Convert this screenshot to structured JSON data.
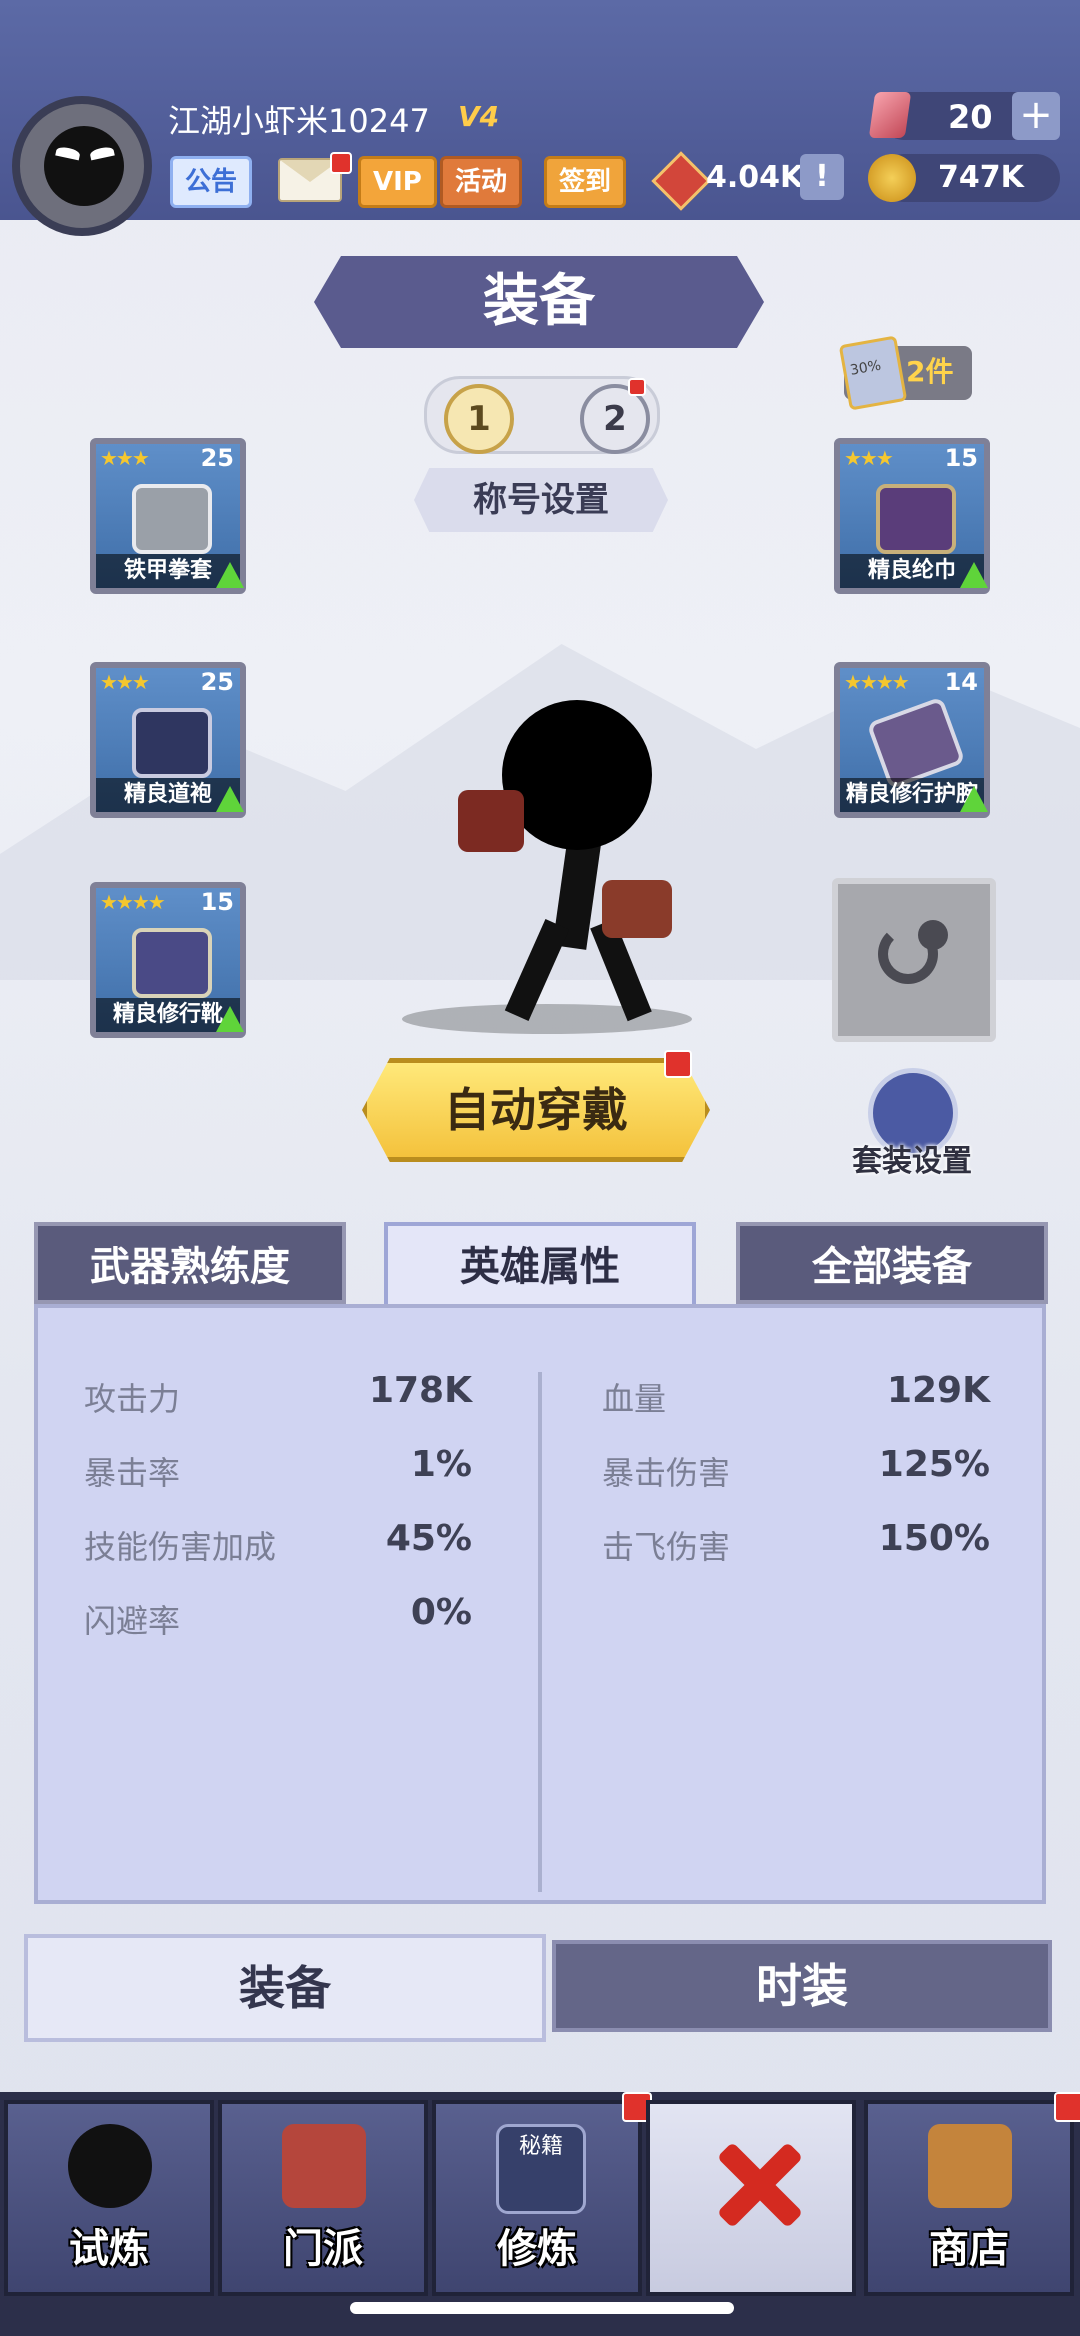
{
  "header": {
    "player_name": "江湖小虾米10247",
    "vip_level": "V4",
    "notice_label": "公告",
    "vip_label": "VIP",
    "event_label": "活动",
    "checkin_label": "签到",
    "honor_value": "4.04K",
    "info_symbol": "!",
    "gems": "20",
    "add_symbol": "+",
    "coins": "747K"
  },
  "equip_screen": {
    "title": "装备",
    "slot_tabs": [
      "1",
      "2"
    ],
    "title_settings_label": "称号设置",
    "set_pieces_label": "2件",
    "set_badge_text": "30%",
    "auto_equip_label": "自动穿戴",
    "suit_settings_label": "套装设置",
    "slots": {
      "gloves": {
        "name": "铁甲拳套",
        "stars": "★★★",
        "level": "25"
      },
      "robe": {
        "name": "精良道袍",
        "stars": "★★★",
        "level": "25"
      },
      "boots": {
        "name": "精良修行靴",
        "stars": "★★★★",
        "level": "15"
      },
      "hat": {
        "name": "精良纶巾",
        "stars": "★★★",
        "level": "15"
      },
      "bracer": {
        "name": "精良修行护腕",
        "stars": "★★★★",
        "level": "14"
      }
    }
  },
  "stat_tabs": [
    "武器熟练度",
    "英雄属性",
    "全部装备"
  ],
  "stats": {
    "left": [
      {
        "label": "攻击力",
        "value": "178K"
      },
      {
        "label": "暴击率",
        "value": "1%"
      },
      {
        "label": "技能伤害加成",
        "value": "45%"
      },
      {
        "label": "闪避率",
        "value": "0%"
      }
    ],
    "right": [
      {
        "label": "血量",
        "value": "129K"
      },
      {
        "label": "暴击伤害",
        "value": "125%"
      },
      {
        "label": "击飞伤害",
        "value": "150%"
      }
    ]
  },
  "bottom_switch": {
    "equipment": "装备",
    "fashion": "时装"
  },
  "nav": [
    {
      "label": "试炼",
      "icon": "ninja-icon"
    },
    {
      "label": "门派",
      "icon": "temple-icon"
    },
    {
      "label": "修炼",
      "icon": "secret-book-icon",
      "icon_text": "秘籍"
    },
    {
      "label": "",
      "icon": "crossed-swords-icon"
    },
    {
      "label": "商店",
      "icon": "shop-icon"
    }
  ],
  "colors": {
    "accent_gold": "#f4c23c",
    "banner_purple": "#5a5b8e",
    "badge_red": "#e0322c"
  }
}
